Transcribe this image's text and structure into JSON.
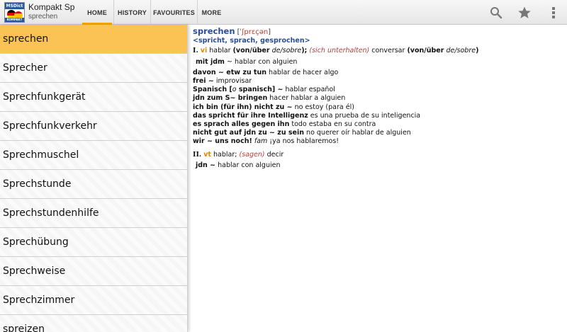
{
  "app": {
    "logo_brand": "MSDict",
    "logo_sub": "KOMPAKT",
    "title": "Kompakt Sp",
    "subtitle": "sprechen"
  },
  "tabs": [
    {
      "label": "HOME",
      "active": true
    },
    {
      "label": "HISTORY",
      "active": false
    },
    {
      "label": "FAVOURITES",
      "active": false
    },
    {
      "label": "MORE",
      "active": false
    }
  ],
  "actions": [
    "search-icon",
    "star-icon",
    "overflow-menu-icon"
  ],
  "colors": {
    "accent": "#f6a800",
    "selected_row": "#fbc353",
    "headword": "#2a4d9a",
    "pos": "#e08a00",
    "gloss": "#b0413e",
    "ipa": "#c0392b"
  },
  "wordlist": {
    "items": [
      "sprechen",
      "Sprecher",
      "Sprechfunkgerät",
      "Sprechfunkverkehr",
      "Sprechmuschel",
      "Sprechstunde",
      "Sprechstundenhilfe",
      "Sprechübung",
      "Sprechweise",
      "Sprechzimmer",
      "spreizen"
    ],
    "selected_index": 0
  },
  "entry": {
    "headword": "sprechen",
    "ipa_open": "[",
    "ipa": "ˈʃprɛçən",
    "ipa_close": "]",
    "forms": "<spricht, sprach, gesprochen>",
    "sense1": {
      "num": "I.",
      "pos": "vi",
      "t1": "hablar",
      "t2": "(von/über",
      "t3": "de/sobre",
      "t4": ");",
      "t5": "(sich unterhalten)",
      "t6": "conversar",
      "t7": "(von/über",
      "t8": "de/sobre",
      "t9": ")",
      "ex1_de": "mit jdm",
      "ex1_tilde": "~",
      "ex1_es": "hablar con alguien"
    },
    "examples": [
      {
        "de": "davon ~ etw zu tun",
        "es": "hablar de hacer algo"
      },
      {
        "de": "frei ~",
        "es": "improvisar"
      },
      {
        "de": "Spanisch [",
        "de_it": "o",
        "de_after": " spanisch] ~",
        "es": "hablar español"
      },
      {
        "de": "jdn zum S~ bringen",
        "es": "hacer hablar a alguien"
      },
      {
        "de": "ich bin (für ihn) nicht zu ~",
        "es": "no estoy (para él)"
      },
      {
        "de": "das spricht für ihre Intelligenz",
        "es": "es una prueba de su inteligencia"
      },
      {
        "de": "es sprach alles gegen ihn",
        "es": "todo estaba en su contra"
      },
      {
        "de": "nicht gut auf jdn zu ~ zu sein",
        "es": "no querer oír hablar de alguien"
      },
      {
        "de": "wir ~ uns noch!",
        "tag": "fam",
        "es": "¡ya nos hablaremos!"
      }
    ],
    "sense2": {
      "num": "II.",
      "pos": "vt",
      "t1": "hablar;",
      "t2": "(sagen)",
      "t3": "decir",
      "ex_de": "jdn ~",
      "ex_es": "hablar con alguien"
    }
  }
}
